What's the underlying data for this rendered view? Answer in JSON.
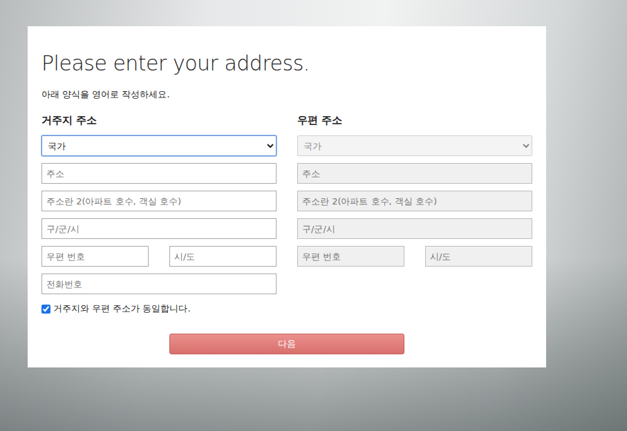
{
  "page": {
    "title": "Please enter your address.",
    "subtitle": "아래 양식을 영어로 작성하세요."
  },
  "sections": [
    {
      "heading": "거주지 주소",
      "disabled": false,
      "country": {
        "label": "국가",
        "focused": true
      },
      "fields": [
        "주소",
        "주소란 2(아파트 호수, 객실 호수)",
        "구/군/시"
      ],
      "postal": "우편 번호",
      "state": "시/도",
      "phone": "전화번호"
    },
    {
      "heading": "우편 주소",
      "disabled": true,
      "country": {
        "label": "국가",
        "focused": false
      },
      "fields": [
        "주소",
        "주소란 2(아파트 호수, 객실 호수)",
        "구/군/시"
      ],
      "postal": "우편 번호",
      "state": "시/도",
      "phone": null
    }
  ],
  "same_address": {
    "label": "거주지와 우편 주소가 동일합니다.",
    "checked": true
  },
  "next_button": {
    "label": "다음"
  }
}
